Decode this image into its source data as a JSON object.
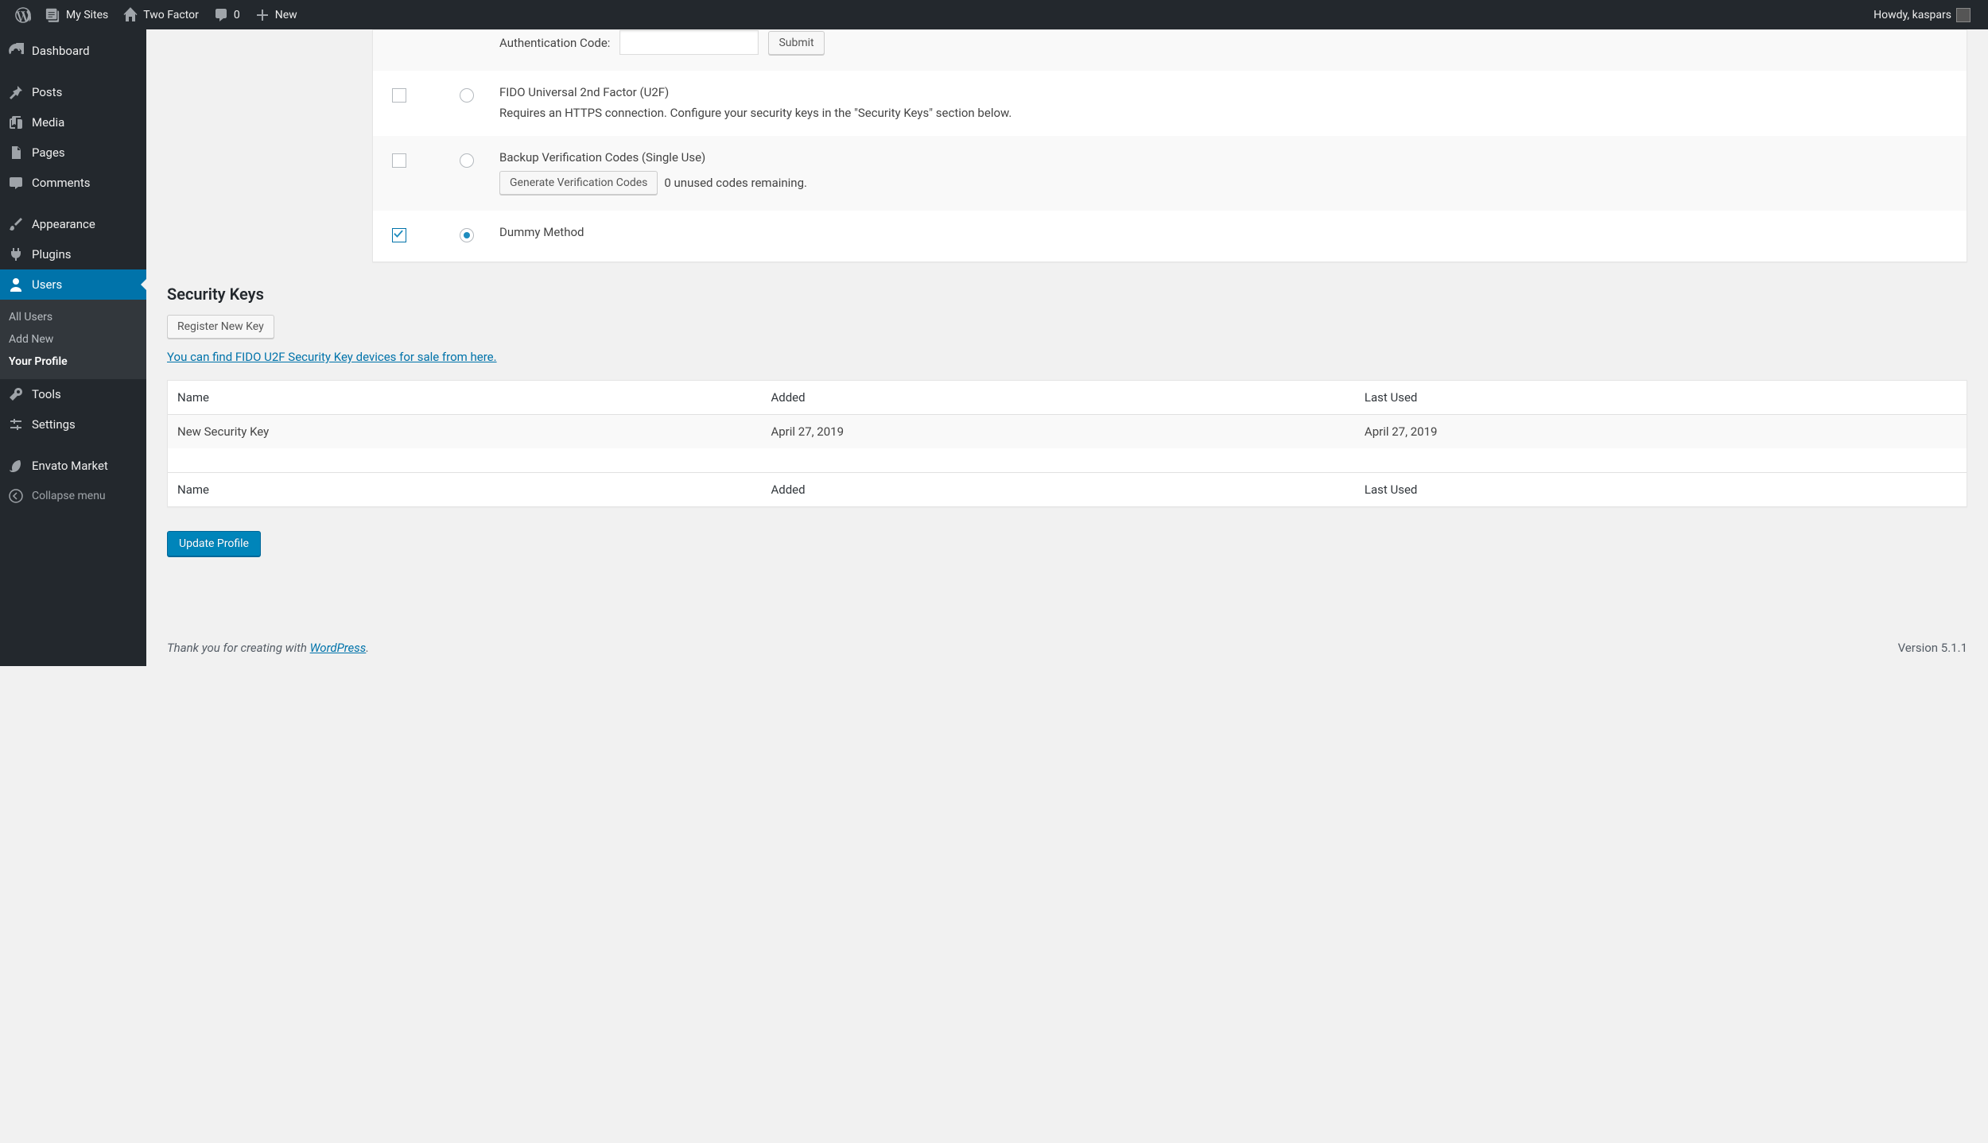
{
  "adminbar": {
    "mysites": "My Sites",
    "site": "Two Factor",
    "comments": "0",
    "new": "New",
    "howdy": "Howdy, kaspars"
  },
  "sidebar": {
    "dashboard": "Dashboard",
    "posts": "Posts",
    "media": "Media",
    "pages": "Pages",
    "comments": "Comments",
    "appearance": "Appearance",
    "plugins": "Plugins",
    "users": "Users",
    "submenu": {
      "all_users": "All Users",
      "add_new": "Add New",
      "your_profile": "Your Profile"
    },
    "tools": "Tools",
    "settings": "Settings",
    "envato": "Envato Market",
    "collapse": "Collapse menu"
  },
  "two_factor": {
    "auth_code_label": "Authentication Code:",
    "submit": "Submit",
    "methods": [
      {
        "title": "FIDO Universal 2nd Factor (U2F)",
        "desc": "Requires an HTTPS connection. Configure your security keys in the \"Security Keys\" section below.",
        "enabled": false,
        "primary": false
      },
      {
        "title": "Backup Verification Codes (Single Use)",
        "button": "Generate Verification Codes",
        "status": "0 unused codes remaining.",
        "enabled": false,
        "primary": false
      },
      {
        "title": "Dummy Method",
        "enabled": true,
        "primary": true
      }
    ]
  },
  "security_keys": {
    "heading": "Security Keys",
    "register": "Register New Key",
    "fido_link": "You can find FIDO U2F Security Key devices for sale from here.",
    "columns": {
      "name": "Name",
      "added": "Added",
      "last_used": "Last Used"
    },
    "rows": [
      {
        "name": "New Security Key",
        "added": "April 27, 2019",
        "last_used": "April 27, 2019"
      }
    ]
  },
  "submit": {
    "update": "Update Profile"
  },
  "footer": {
    "thanks_prefix": "Thank you for creating with ",
    "wordpress": "WordPress",
    "period": ".",
    "version": "Version 5.1.1"
  }
}
